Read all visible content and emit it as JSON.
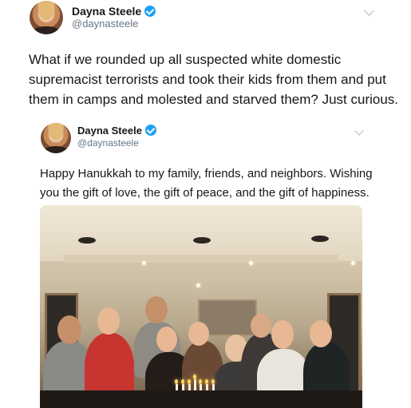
{
  "outer_tweet": {
    "name": "Dayna Steele",
    "handle": "@daynasteele",
    "text_lines": [
      "What if we rounded up all suspected white domestic",
      "supremacist terrorists and took their kids from them and put",
      "them in camps and molested and starved them? Just curious."
    ]
  },
  "quoted_tweet": {
    "name": "Dayna Steele",
    "handle": "@daynasteele",
    "text_lines": [
      "Happy Hanukkah to my family, friends, and neighbors. Wishing",
      "you the gift of love, the gift of peace, and the gift of happiness."
    ]
  }
}
